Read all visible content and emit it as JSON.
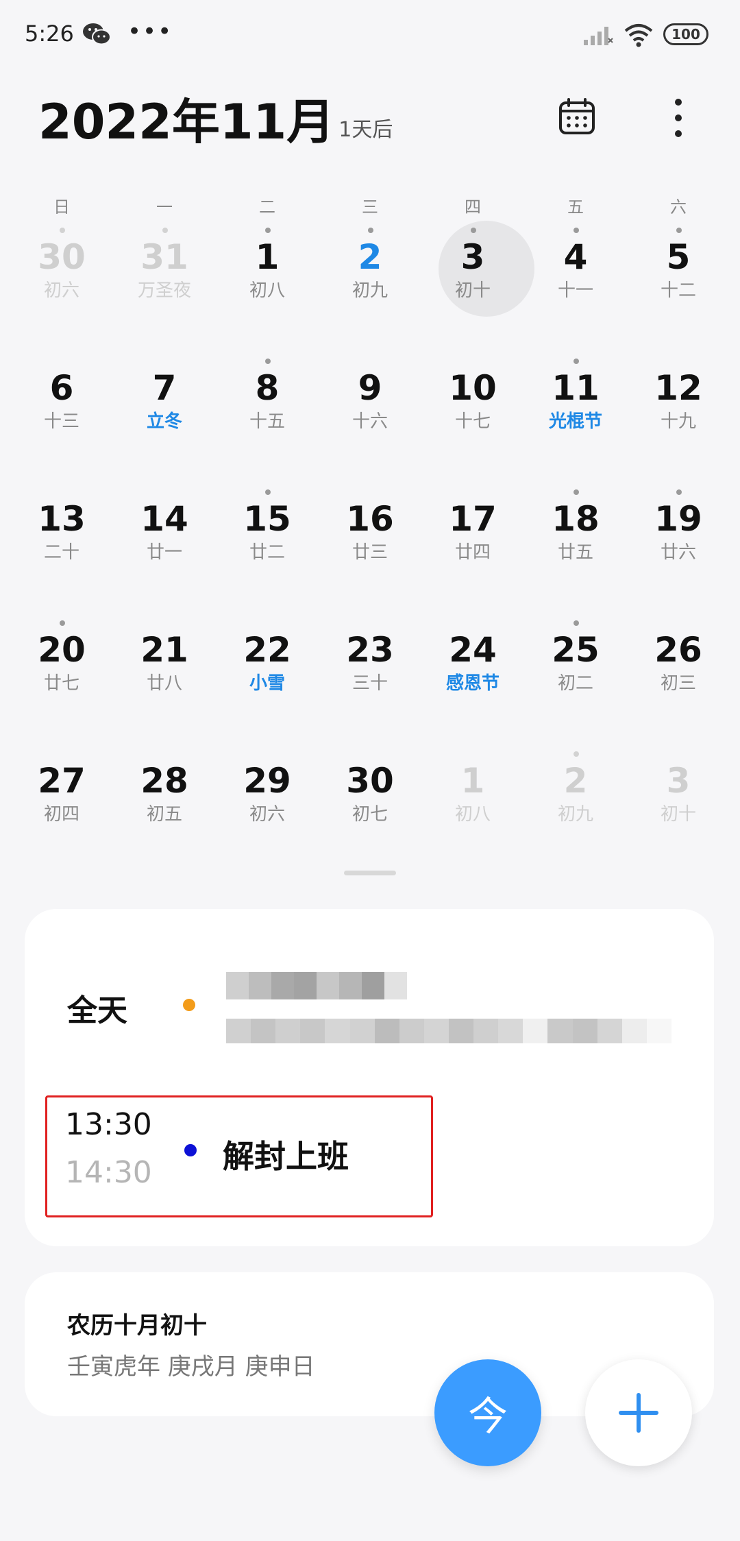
{
  "status_bar": {
    "time": "5:26",
    "battery": "100",
    "icons": [
      "wechat-icon",
      "more-icon",
      "signal-icon",
      "wifi-icon",
      "battery-icon"
    ]
  },
  "header": {
    "title": "2022年11月",
    "subtitle": "1天后",
    "icons": [
      "calendar-icon",
      "kebab-menu-icon"
    ]
  },
  "weekdays": [
    "日",
    "一",
    "二",
    "三",
    "四",
    "五",
    "六"
  ],
  "days": [
    {
      "n": "30",
      "l": "初六",
      "dot": true,
      "faded": true
    },
    {
      "n": "31",
      "l": "万圣夜",
      "dot": true,
      "faded": true
    },
    {
      "n": "1",
      "l": "初八",
      "dot": true
    },
    {
      "n": "2",
      "l": "初九",
      "dot": true,
      "blue": true
    },
    {
      "n": "3",
      "l": "初十",
      "dot": true,
      "selected": true
    },
    {
      "n": "4",
      "l": "十一",
      "dot": true
    },
    {
      "n": "5",
      "l": "十二",
      "dot": true
    },
    {
      "n": "6",
      "l": "十三"
    },
    {
      "n": "7",
      "l": "立冬",
      "hl": true
    },
    {
      "n": "8",
      "l": "十五",
      "dot": true
    },
    {
      "n": "9",
      "l": "十六"
    },
    {
      "n": "10",
      "l": "十七"
    },
    {
      "n": "11",
      "l": "光棍节",
      "dot": true,
      "hl": true
    },
    {
      "n": "12",
      "l": "十九"
    },
    {
      "n": "13",
      "l": "二十"
    },
    {
      "n": "14",
      "l": "廿一"
    },
    {
      "n": "15",
      "l": "廿二",
      "dot": true
    },
    {
      "n": "16",
      "l": "廿三"
    },
    {
      "n": "17",
      "l": "廿四"
    },
    {
      "n": "18",
      "l": "廿五",
      "dot": true
    },
    {
      "n": "19",
      "l": "廿六",
      "dot": true
    },
    {
      "n": "20",
      "l": "廿七",
      "dot": true
    },
    {
      "n": "21",
      "l": "廿八"
    },
    {
      "n": "22",
      "l": "小雪",
      "hl": true
    },
    {
      "n": "23",
      "l": "三十"
    },
    {
      "n": "24",
      "l": "感恩节",
      "hl": true
    },
    {
      "n": "25",
      "l": "初二",
      "dot": true
    },
    {
      "n": "26",
      "l": "初三"
    },
    {
      "n": "27",
      "l": "初四"
    },
    {
      "n": "28",
      "l": "初五"
    },
    {
      "n": "29",
      "l": "初六"
    },
    {
      "n": "30",
      "l": "初七"
    },
    {
      "n": "1",
      "l": "初八",
      "faded": true
    },
    {
      "n": "2",
      "l": "初九",
      "dot": true,
      "faded": true
    },
    {
      "n": "3",
      "l": "初十",
      "faded": true
    }
  ],
  "events_card": {
    "all_day_label": "全天",
    "all_day_dot_color": "#f39c1a",
    "timed_event": {
      "start": "13:30",
      "end": "14:30",
      "title": "解封上班",
      "dot_color": "#0d11d6"
    }
  },
  "lunar_card": {
    "line1": "农历十月初十",
    "line2": "壬寅虎年 庚戌月 庚申日"
  },
  "fab": {
    "today_label": "今",
    "today_color": "#3b9cff",
    "add_icon": "plus-icon"
  }
}
